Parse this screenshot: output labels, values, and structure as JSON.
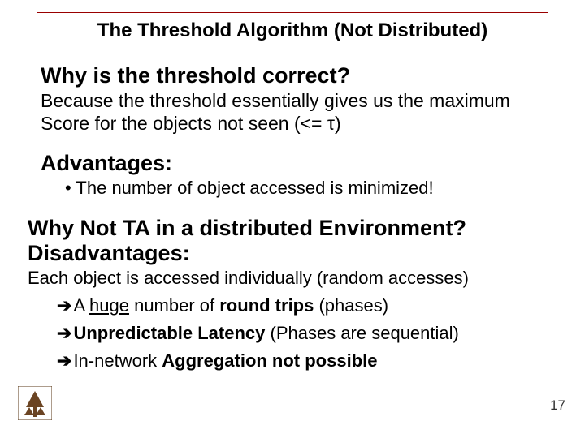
{
  "title": "The Threshold Algorithm (Not Distributed)",
  "section1": {
    "heading": "Why is the threshold correct?",
    "body": "Because the threshold essentially gives us the maximum Score for the objects not seen (<= τ)"
  },
  "section2": {
    "heading": "Advantages:",
    "bullet": "• The number of object accessed is minimized!"
  },
  "section3": {
    "heading_line1": "Why Not TA in a distributed Environment?",
    "heading_line2": "Disadvantages:",
    "body": "Each object is accessed individually (random accesses)",
    "arrow": "➔",
    "pt1_a": "A ",
    "pt1_huge": "huge",
    "pt1_b": " number of ",
    "pt1_bold": "round trips",
    "pt1_c": " (phases)",
    "pt2_bold": "Unpredictable Latency",
    "pt2_rest": " (Phases are sequential)",
    "pt3_a": "In-network ",
    "pt3_bold": "Aggregation not possible"
  },
  "page_number": "17"
}
